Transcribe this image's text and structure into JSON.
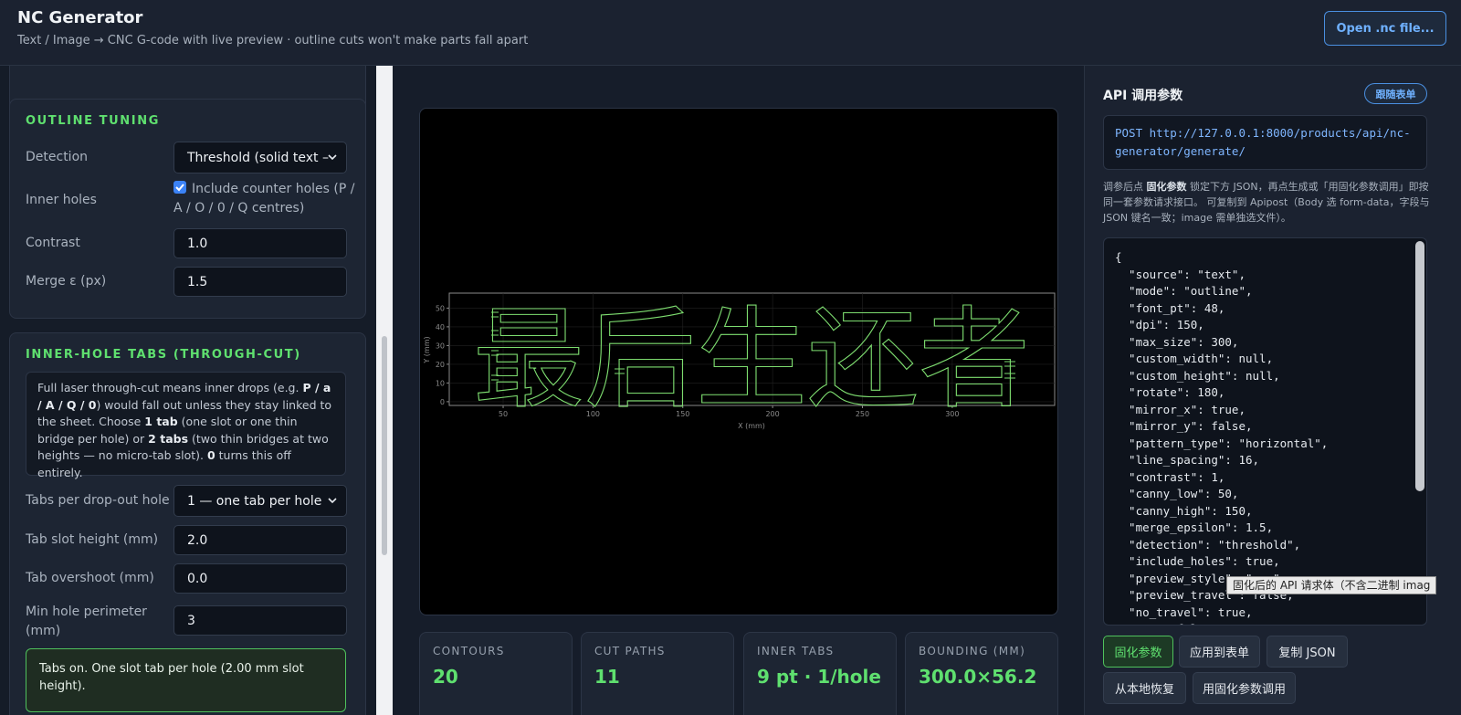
{
  "header": {
    "title": "NC Generator",
    "subtitle": "Text / Image → CNC G-code with live preview · outline cuts won't make parts fall apart",
    "open_button": "Open .nc file..."
  },
  "outline_tuning": {
    "title": "OUTLINE TUNING",
    "detection_label": "Detection",
    "detection_value": "Threshold (solid text –",
    "inner_holes_label": "Inner holes",
    "inner_holes_checked": true,
    "inner_holes_text": "Include counter holes (P / A / O / 0 / Q centres)",
    "contrast_label": "Contrast",
    "contrast_value": "1.0",
    "merge_label": "Merge ε (px)",
    "merge_value": "1.5"
  },
  "inner_tabs": {
    "title": "INNER-HOLE TABS (THROUGH-CUT)",
    "info_1": "Full laser through-cut means inner drops (e.g. ",
    "info_b1": "P / a / A / Q / 0",
    "info_2": ") would fall out unless they stay linked to the sheet. Choose ",
    "info_b2": "1 tab",
    "info_3": " (one slot or one thin bridge per hole) or ",
    "info_b3": "2 tabs",
    "info_4": " (two thin bridges at two heights — no micro-tab slot). ",
    "info_b4": "0",
    "info_5": " turns this off entirely.",
    "tabs_per_hole_label": "Tabs per drop-out hole",
    "tabs_per_hole_value": "1 — one tab per hole",
    "slot_height_label": "Tab slot height (mm)",
    "slot_height_value": "2.0",
    "overshoot_label": "Tab overshoot (mm)",
    "overshoot_value": "0.0",
    "min_perimeter_label": "Min hole perimeter (mm)",
    "min_perimeter_value": "3",
    "status_text": "Tabs on. One slot tab per hole (2.00 mm slot height)."
  },
  "stats": {
    "contours_label": "CONTOURS",
    "contours_value": "20",
    "cut_paths_label": "CUT PATHS",
    "cut_paths_value": "11",
    "inner_tabs_label": "INNER TABS",
    "inner_tabs_value": "9 pt · 1/hole",
    "bounding_label": "BOUNDING (MM)",
    "bounding_value": "300.0×56.2"
  },
  "chart_data": {
    "type": "line",
    "title": "",
    "xlabel": "X (mm)",
    "ylabel": "Y (mm)",
    "xlim": [
      20,
      357
    ],
    "ylim": [
      -2,
      58
    ],
    "xticks": [
      "50",
      "100",
      "150",
      "200",
      "250",
      "300"
    ],
    "yticks": [
      "0",
      "10",
      "20",
      "30",
      "40",
      "50"
    ],
    "series_text": "最后生还者",
    "color": "#7ddc6f",
    "background": "#000000"
  },
  "api": {
    "title": "API 调用参数",
    "follow_button": "跟随表单",
    "method": "POST",
    "url": "http://127.0.0.1:8000/products/api/nc-generator/generate/",
    "note_1": "调参后点 ",
    "note_b": "固化参数",
    "note_2": " 锁定下方 JSON，再点生成或「用固化参数调用」即按同一套参数请求接口。 可复制到 Apipost（Body 选 form-data，字段与 JSON 键名一致；image 需单独选文件）。",
    "json_text": "{\n  \"source\": \"text\",\n  \"mode\": \"outline\",\n  \"font_pt\": 48,\n  \"dpi\": 150,\n  \"max_size\": 300,\n  \"custom_width\": null,\n  \"custom_height\": null,\n  \"rotate\": 180,\n  \"mirror_x\": true,\n  \"mirror_y\": false,\n  \"pattern_type\": \"horizontal\",\n  \"line_spacing\": 16,\n  \"contrast\": 1,\n  \"canny_low\": 50,\n  \"canny_high\": 150,\n  \"merge_epsilon\": 1.5,\n  \"detection\": \"threshold\",\n  \"include_holes\": true,\n  \"preview_style\": \"...\",\n  \"preview_travel\": false,\n  \"no_travel\": true,\n  \"...\": false",
    "tooltip": "固化后的 API 请求体（不含二进制 imag",
    "btn_freeze": "固化参数",
    "btn_apply": "应用到表单",
    "btn_copy": "复制 JSON",
    "btn_restore": "从本地恢复",
    "btn_call": "用固化参数调用"
  }
}
